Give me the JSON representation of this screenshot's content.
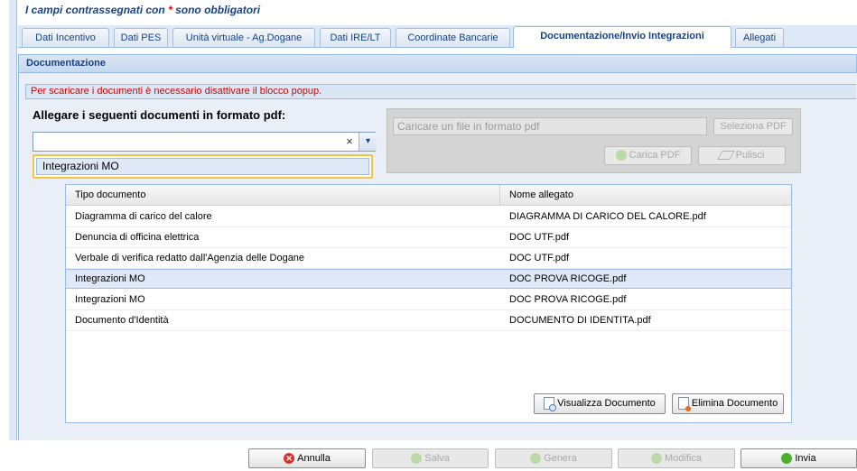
{
  "required_note": {
    "prefix": "I campi contrassegnati con",
    "star": "*",
    "suffix": "sono obbligatori"
  },
  "tabs": [
    {
      "label": "Dati Incentivo",
      "active": false
    },
    {
      "label": "Dati PES",
      "active": false
    },
    {
      "label": "Unità virtuale - Ag.Dogane",
      "active": false
    },
    {
      "label": "Dati IRE/LT",
      "active": false
    },
    {
      "label": "Coordinate Bancarie",
      "active": false
    },
    {
      "label": "Documentazione/Invio Integrazioni",
      "active": true
    },
    {
      "label": "Allegati",
      "active": false
    }
  ],
  "section": {
    "title": "Documentazione"
  },
  "popup_warning": "Per scaricare i documenti è necessario disattivare il blocco popup.",
  "attach": {
    "label": "Allegare i seguenti documenti in formato pdf:",
    "combo_value": "",
    "clear_glyph": "×",
    "arrow_glyph": "▾",
    "dropdown_item": "Integrazioni MO"
  },
  "upload": {
    "placeholder": "Caricare un file in formato pdf",
    "select_label": "Seleziona PDF",
    "upload_label": "Carica PDF",
    "clear_label": "Pulisci"
  },
  "grid": {
    "columns": [
      "Tipo documento",
      "Nome allegato"
    ],
    "rows": [
      {
        "tipo": "Diagramma di carico del calore",
        "nome": "DIAGRAMMA DI CARICO DEL CALORE.pdf",
        "selected": false
      },
      {
        "tipo": "Denuncia di officina elettrica",
        "nome": "DOC UTF.pdf",
        "selected": false
      },
      {
        "tipo": "Verbale di verifica redatto dall'Agenzia delle Dogane",
        "nome": "DOC UTF.pdf",
        "selected": false
      },
      {
        "tipo": "Integrazioni MO",
        "nome": "DOC PROVA RICOGE.pdf",
        "selected": true
      },
      {
        "tipo": "Integrazioni MO",
        "nome": "DOC PROVA RICOGE.pdf",
        "selected": false
      },
      {
        "tipo": "Documento d'Identità",
        "nome": "DOCUMENTO DI IDENTITA.pdf",
        "selected": false
      }
    ],
    "view_label": "Visualizza Documento",
    "delete_label": "Elimina Documento"
  },
  "footer": {
    "cancel": "Annulla",
    "save": "Salva",
    "generate": "Genera",
    "modify": "Modifica",
    "send": "Invia"
  },
  "colors": {
    "accent": "#15428b",
    "warning": "#d90000",
    "selection": "#dfe8f6",
    "required_star": "#e00000"
  }
}
